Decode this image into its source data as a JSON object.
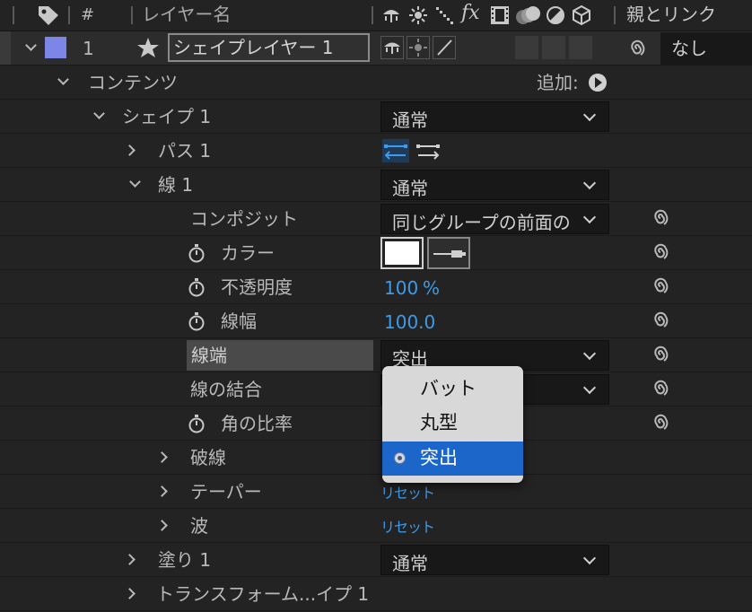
{
  "header": {
    "hash": "#",
    "layer_name_col": "レイヤー名",
    "fx_label": "fx",
    "parent_col": "親とリンク"
  },
  "layer": {
    "number": "1",
    "name": "シェイプレイヤー 1",
    "parent_value": "なし",
    "label_color": "#7b86e6"
  },
  "rows": {
    "contents": "コンテンツ",
    "add_label": "追加:",
    "shape1": "シェイプ 1",
    "shape1_mode": "通常",
    "path1": "パス 1",
    "stroke1": "線 1",
    "stroke1_mode": "通常",
    "composite": "コンポジット",
    "composite_value": "同じグループの前面の",
    "color": "カラー",
    "opacity": "不透明度",
    "opacity_value": "100",
    "opacity_unit": "%",
    "width": "線幅",
    "width_value": "100.0",
    "cap": "線端",
    "cap_value": "突出",
    "join": "線の結合",
    "miter": "角の比率",
    "dashes": "破線",
    "taper": "テーパー",
    "taper_reset": "リセット",
    "wave": "波",
    "wave_reset": "リセット",
    "fill1": "塗り 1",
    "fill1_mode": "通常",
    "transform": "トランスフォーム...イプ 1"
  },
  "popup": {
    "options": [
      "バット",
      "丸型",
      "突出"
    ],
    "selected_index": 2
  },
  "colors": {
    "bg": "#232323",
    "accent_blue": "#3d9be9",
    "selected_blue": "#1c66c9",
    "stroke_color": "#ffffff"
  }
}
